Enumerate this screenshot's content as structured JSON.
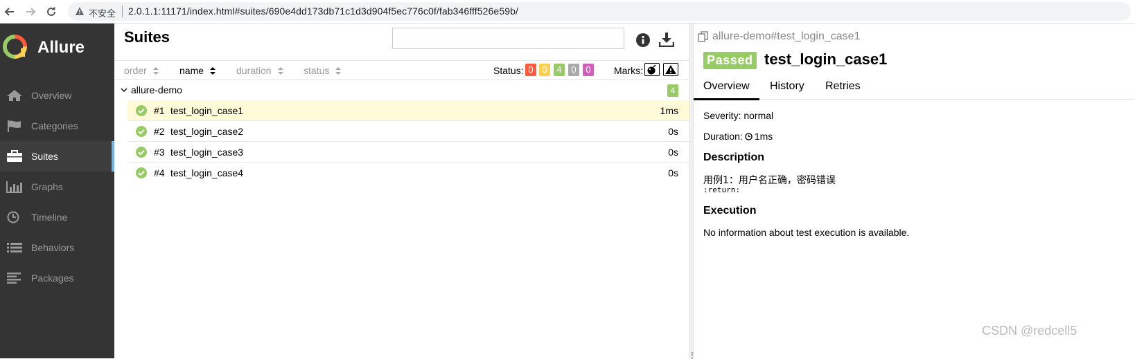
{
  "browser": {
    "security_label": "不安全",
    "url": "2.0.1.1:11171/index.html#suites/690e4dd173db71c1d3d904f5ec776c0f/fab346fff526e59b/"
  },
  "sidebar": {
    "brand": "Allure",
    "items": [
      {
        "label": "Overview",
        "icon": "home-icon"
      },
      {
        "label": "Categories",
        "icon": "flag-icon"
      },
      {
        "label": "Suites",
        "icon": "briefcase-icon",
        "active": true
      },
      {
        "label": "Graphs",
        "icon": "bar-chart-icon"
      },
      {
        "label": "Timeline",
        "icon": "clock-icon"
      },
      {
        "label": "Behaviors",
        "icon": "list-icon"
      },
      {
        "label": "Packages",
        "icon": "align-left-icon"
      }
    ]
  },
  "suites": {
    "title": "Suites",
    "search_value": "",
    "sort": [
      "order",
      "name",
      "duration",
      "status"
    ],
    "status_label": "Status:",
    "status_counts": [
      {
        "value": "0",
        "color": "#fd5a3e"
      },
      {
        "value": "0",
        "color": "#ffd050"
      },
      {
        "value": "4",
        "color": "#97cc64"
      },
      {
        "value": "0",
        "color": "#aaaaaa"
      },
      {
        "value": "0",
        "color": "#d35ebe"
      }
    ],
    "marks_label": "Marks:",
    "group": {
      "name": "allure-demo",
      "count": "4"
    },
    "rows": [
      {
        "num": "#1",
        "name": "test_login_case1",
        "duration": "1ms"
      },
      {
        "num": "#2",
        "name": "test_login_case2",
        "duration": "0s"
      },
      {
        "num": "#3",
        "name": "test_login_case3",
        "duration": "0s"
      },
      {
        "num": "#4",
        "name": "test_login_case4",
        "duration": "0s"
      }
    ]
  },
  "detail": {
    "breadcrumb": "allure-demo#test_login_case1",
    "status": "Passed",
    "title": "test_login_case1",
    "tabs": [
      "Overview",
      "History",
      "Retries"
    ],
    "severity": "Severity: normal",
    "duration_label": "Duration:",
    "duration_value": "1ms",
    "description_heading": "Description",
    "description_text": "用例1：用户名正确，密码错误",
    "description_code": ":return:",
    "execution_heading": "Execution",
    "execution_text": "No information about test execution is available."
  },
  "watermark": "CSDN @redcell5"
}
